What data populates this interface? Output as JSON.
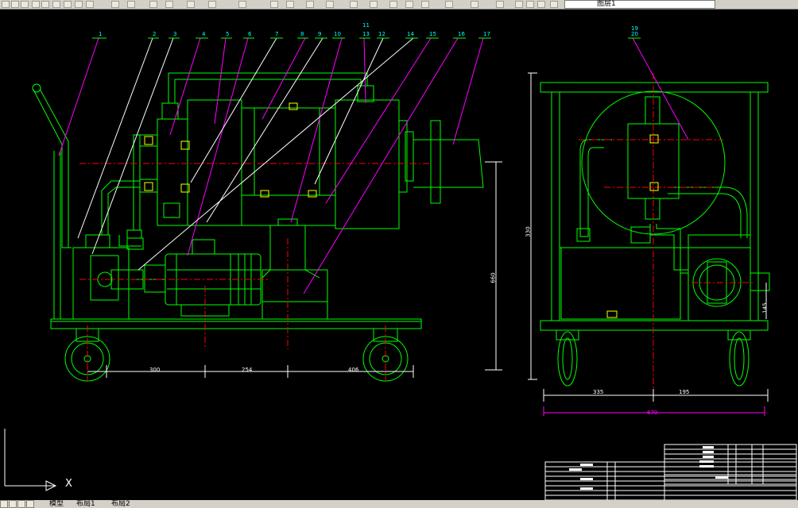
{
  "toolbar": {
    "layer_name": "图层1"
  },
  "tabs": {
    "model": "模型",
    "layout1": "布局1",
    "layout2": "布局2"
  },
  "ucs": {
    "x_label": "X"
  },
  "front_view": {
    "balloons": [
      "1",
      "2",
      "3",
      "4",
      "5",
      "6",
      "7",
      "8",
      "9",
      "10",
      "11",
      "12",
      "14",
      "15",
      "16",
      "17",
      "18"
    ],
    "balloon_13": "13",
    "dims": {
      "d1": "300",
      "d2": "254",
      "d3": "406",
      "height": "660"
    }
  },
  "side_view": {
    "balloons": [
      "19",
      "20"
    ],
    "dims": {
      "d1": "335",
      "d2": "195",
      "width": "670",
      "height": "330",
      "small": "145"
    }
  },
  "title_block": {
    "rows": [
      "1",
      "2",
      "3",
      "4",
      "5",
      "6",
      "7",
      "8",
      "9",
      "10",
      "11"
    ]
  },
  "colors": {
    "green": "#00ff00",
    "magenta": "#ff00ff",
    "red": "#ff0000",
    "white": "#ffffff",
    "cyan": "#00ffff",
    "yellow": "#ffff00"
  }
}
